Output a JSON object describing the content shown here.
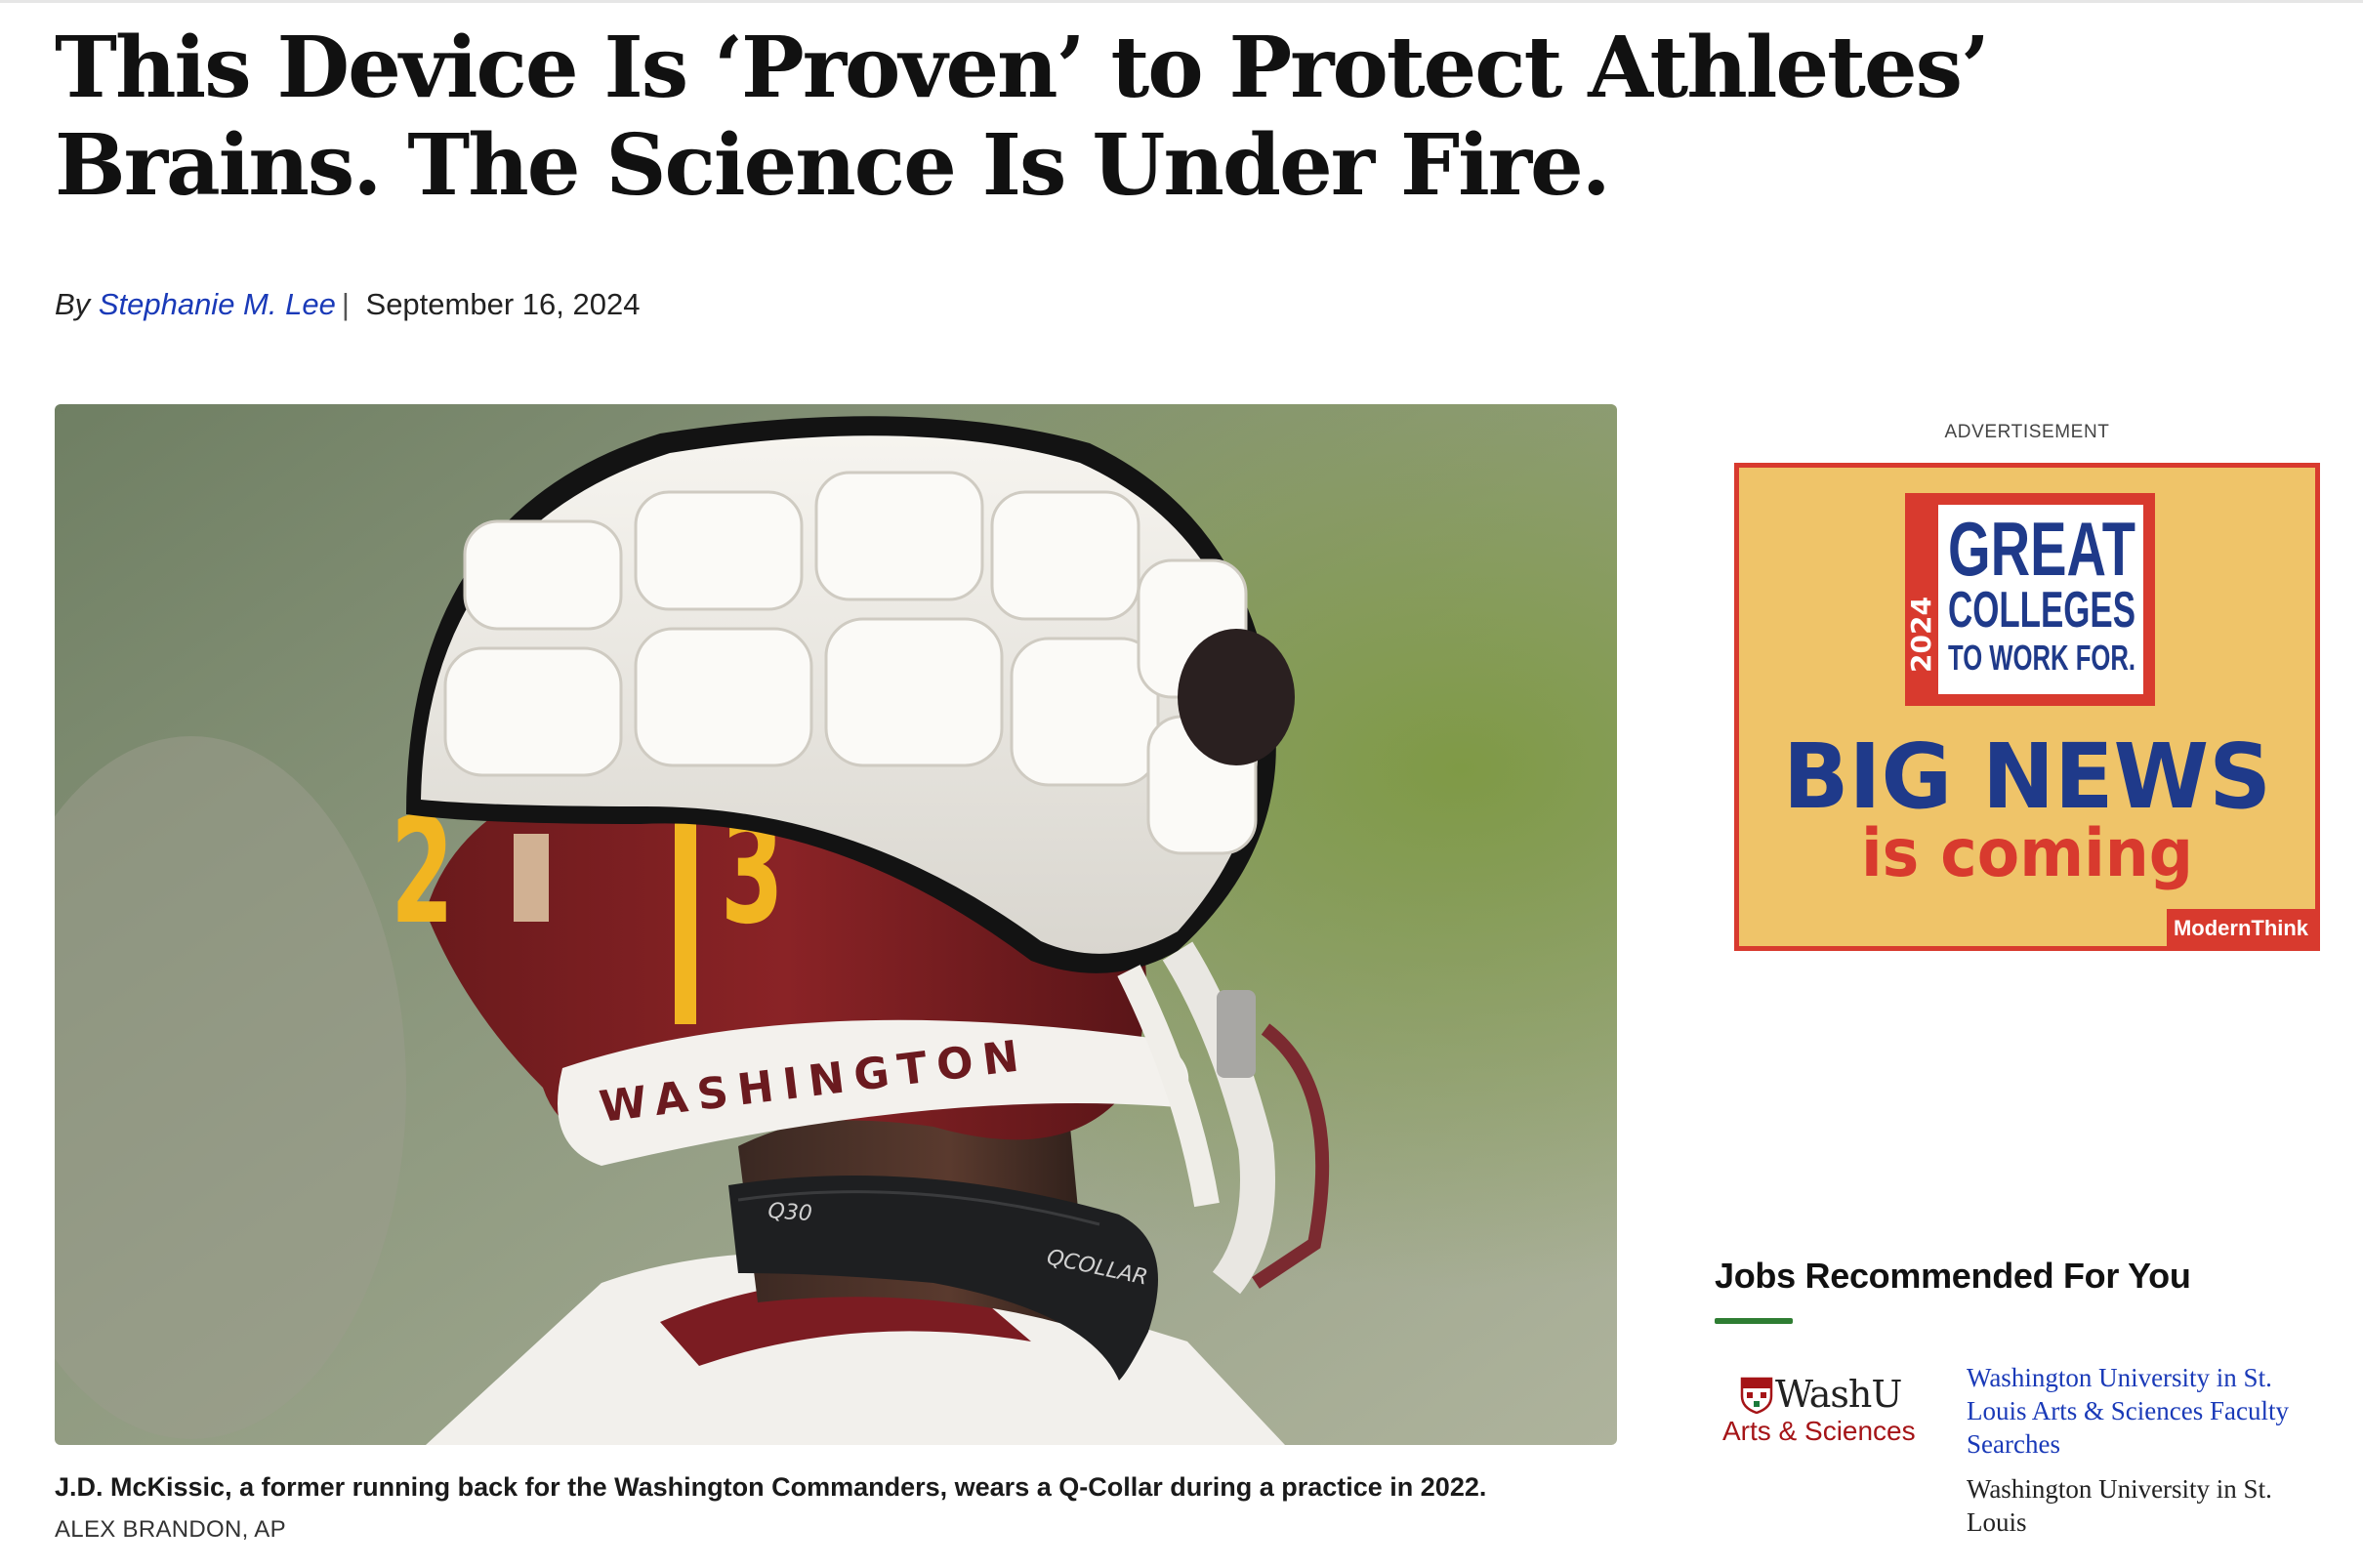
{
  "article": {
    "headline": "This Device Is ‘Proven’ to Protect Athletes’ Brains. The Science Is Under Fire.",
    "byline_prefix": "By",
    "author": "Stephanie M. Lee",
    "separator": "|",
    "date": "September 16, 2024"
  },
  "hero": {
    "helmet_number": "213",
    "helmet_text": "WASHINGTON",
    "collar_text_1": "Q30",
    "collar_text_2": "QCOLLAR",
    "caption": "J.D. McKissic, a former running back for the Washington Commanders, wears a Q-Collar during a practice in 2022.",
    "credit": "ALEX BRANDON, AP"
  },
  "sidebar": {
    "ad_label": "ADVERTISEMENT",
    "ad": {
      "year": "2024",
      "line1": "GREAT",
      "line2": "COLLEGES",
      "line3": "TO WORK FOR.",
      "headline": "BIG NEWS",
      "subheadline": "is coming",
      "brand": "ModernThink"
    },
    "jobs": {
      "title": "Jobs Recommended For You",
      "items": [
        {
          "logo_name": "WashU",
          "logo_dept": "Arts & Sciences",
          "title": "Washington University in St. Louis Arts & Sciences Faculty Searches",
          "organization": "Washington University in St. Louis"
        }
      ]
    }
  },
  "colors": {
    "link": "#1a3ab8",
    "accent_green": "#2e7d32",
    "ad_red": "#d83a2e",
    "ad_gold": "#efc469",
    "ad_navy": "#1f3a8a",
    "washu_red": "#a51417"
  }
}
